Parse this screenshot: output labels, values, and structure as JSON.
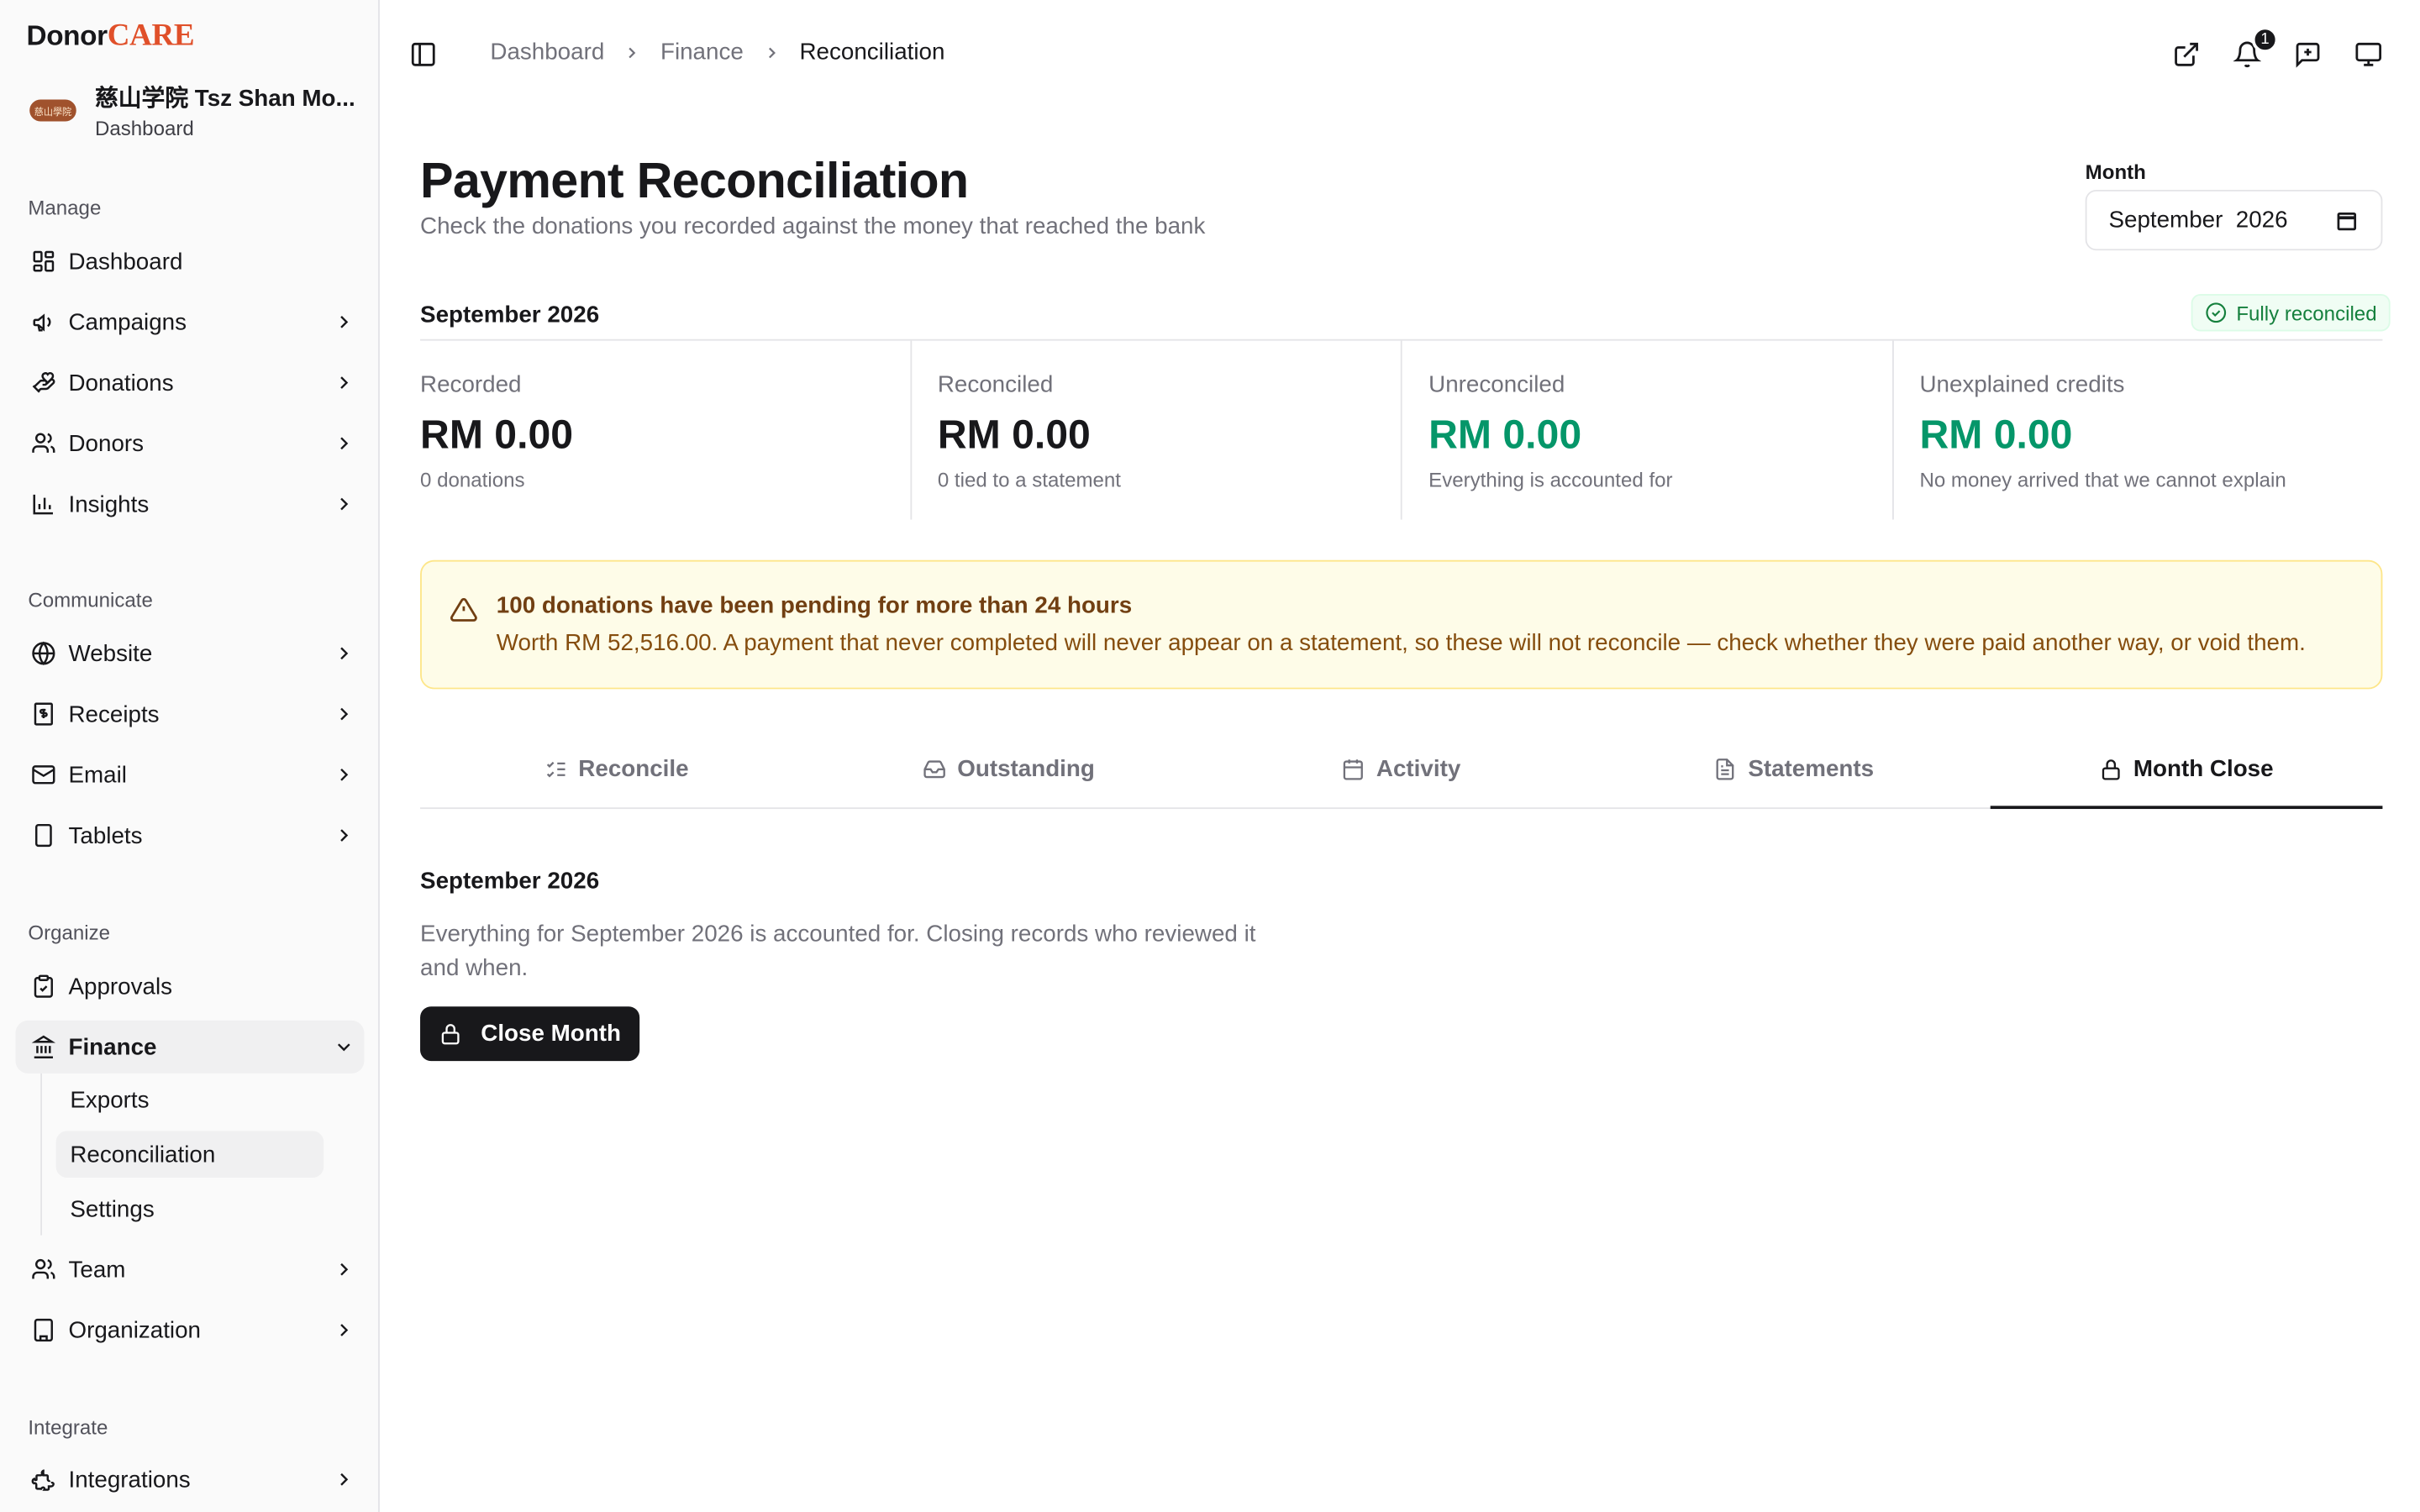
{
  "brand": {
    "name_part1": "Donor",
    "name_part2": "CARE",
    "accent": "#e0502a"
  },
  "organization": {
    "name": "慈山学院 Tsz Shan Mo...",
    "subtitle": "Dashboard",
    "logo_text": "慈山學院"
  },
  "sidebar": {
    "sections": {
      "manage": "Manage",
      "communicate": "Communicate",
      "organize": "Organize",
      "integrate": "Integrate"
    },
    "items": {
      "dashboard": "Dashboard",
      "campaigns": "Campaigns",
      "donations": "Donations",
      "donors": "Donors",
      "insights": "Insights",
      "website": "Website",
      "receipts": "Receipts",
      "email": "Email",
      "tablets": "Tablets",
      "approvals": "Approvals",
      "finance": "Finance",
      "exports": "Exports",
      "reconciliation": "Reconciliation",
      "settings": "Settings",
      "team": "Team",
      "organization": "Organization",
      "integrations": "Integrations"
    }
  },
  "header": {
    "breadcrumb": [
      "Dashboard",
      "Finance",
      "Reconciliation"
    ],
    "notification_count": "1",
    "icons": [
      "sidebar-toggle-icon",
      "external-link-icon",
      "bell-icon",
      "message-plus-icon",
      "monitor-icon"
    ]
  },
  "page": {
    "title": "Payment Reconciliation",
    "subtitle": "Check the donations you recorded against the money that reached the bank",
    "month_label": "Month",
    "month_value": "September  2026"
  },
  "summary": {
    "period": "September 2026",
    "status": "Fully reconciled",
    "stats": [
      {
        "label": "Recorded",
        "value": "RM 0.00",
        "note": "0 donations"
      },
      {
        "label": "Reconciled",
        "value": "RM 0.00",
        "note": "0 tied to a statement"
      },
      {
        "label": "Unreconciled",
        "value": "RM 0.00",
        "note": "Everything is accounted for"
      },
      {
        "label": "Unexplained credits",
        "value": "RM 0.00",
        "note": "No money arrived that we cannot explain"
      }
    ]
  },
  "alert": {
    "title": "100 donations have been pending for more than 24 hours",
    "body": "Worth RM 52,516.00. A payment that never completed will never appear on a statement, so these will not reconcile — check whether they were paid another way, or void them."
  },
  "tabs": {
    "reconcile": "Reconcile",
    "outstanding": "Outstanding",
    "activity": "Activity",
    "statements": "Statements",
    "month_close": "Month Close",
    "active": "Month Close"
  },
  "month_close": {
    "title": "September 2026",
    "description": "Everything for September 2026 is accounted for. Closing records who reviewed it and when.",
    "button": "Close Month"
  },
  "colors": {
    "positive": "#059669",
    "warning_bg": "#fefce8",
    "warning_text": "#854d0e",
    "primary": "#18181b"
  }
}
